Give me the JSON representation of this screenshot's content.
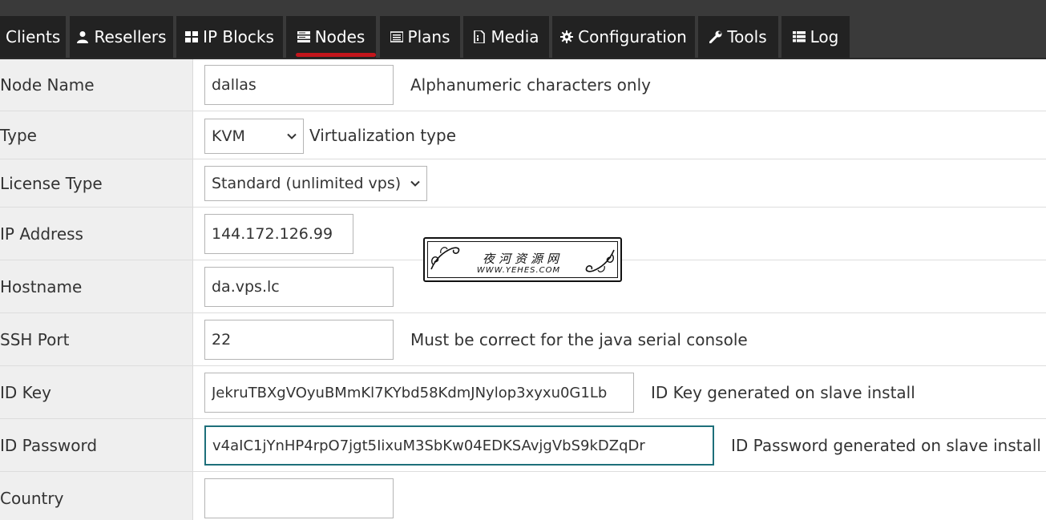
{
  "nav": {
    "tabs": [
      {
        "label": "Clients",
        "icon": "none"
      },
      {
        "label": "Resellers",
        "icon": "user-icon"
      },
      {
        "label": "IP Blocks",
        "icon": "grid-icon"
      },
      {
        "label": "Nodes",
        "icon": "server-icon",
        "active": true
      },
      {
        "label": "Plans",
        "icon": "list-icon"
      },
      {
        "label": "Media",
        "icon": "file-icon"
      },
      {
        "label": "Configuration",
        "icon": "gear-icon"
      },
      {
        "label": "Tools",
        "icon": "wrench-icon"
      },
      {
        "label": "Log",
        "icon": "table-list-icon"
      }
    ],
    "active_underline_color": "#c4161c"
  },
  "form": {
    "node_name": {
      "label": "Node Name",
      "value": "dallas",
      "help": "Alphanumeric characters only"
    },
    "type": {
      "label": "Type",
      "value": "KVM",
      "help": "Virtualization type"
    },
    "license_type": {
      "label": "License Type",
      "value": "Standard (unlimited vps)"
    },
    "ip_address": {
      "label": "IP Address",
      "value": "144.172.126.99"
    },
    "hostname": {
      "label": "Hostname",
      "value": "da.vps.lc"
    },
    "ssh_port": {
      "label": "SSH Port",
      "value": "22",
      "help": "Must be correct for the java serial console"
    },
    "id_key": {
      "label": "ID Key",
      "value": "JekruTBXgVOyuBMmKl7KYbd58KdmJNylop3xyxu0G1Lb",
      "help": "ID Key generated on slave install"
    },
    "id_password": {
      "label": "ID Password",
      "value": "v4aIC1jYnHP4rpO7jgt5IixuM3SbKw04EDKSAvjgVbS9kDZqDr",
      "help": "ID Password generated on slave install"
    },
    "country": {
      "label": "Country",
      "value": ""
    }
  },
  "watermark": {
    "title": "夜河资源网",
    "subtitle": "WWW.YEHES.COM"
  },
  "colors": {
    "nav_bg": "#3a3a3a",
    "tab_bg": "#222222",
    "label_col_bg": "#efefef",
    "focus_border": "#1e6f7a"
  }
}
